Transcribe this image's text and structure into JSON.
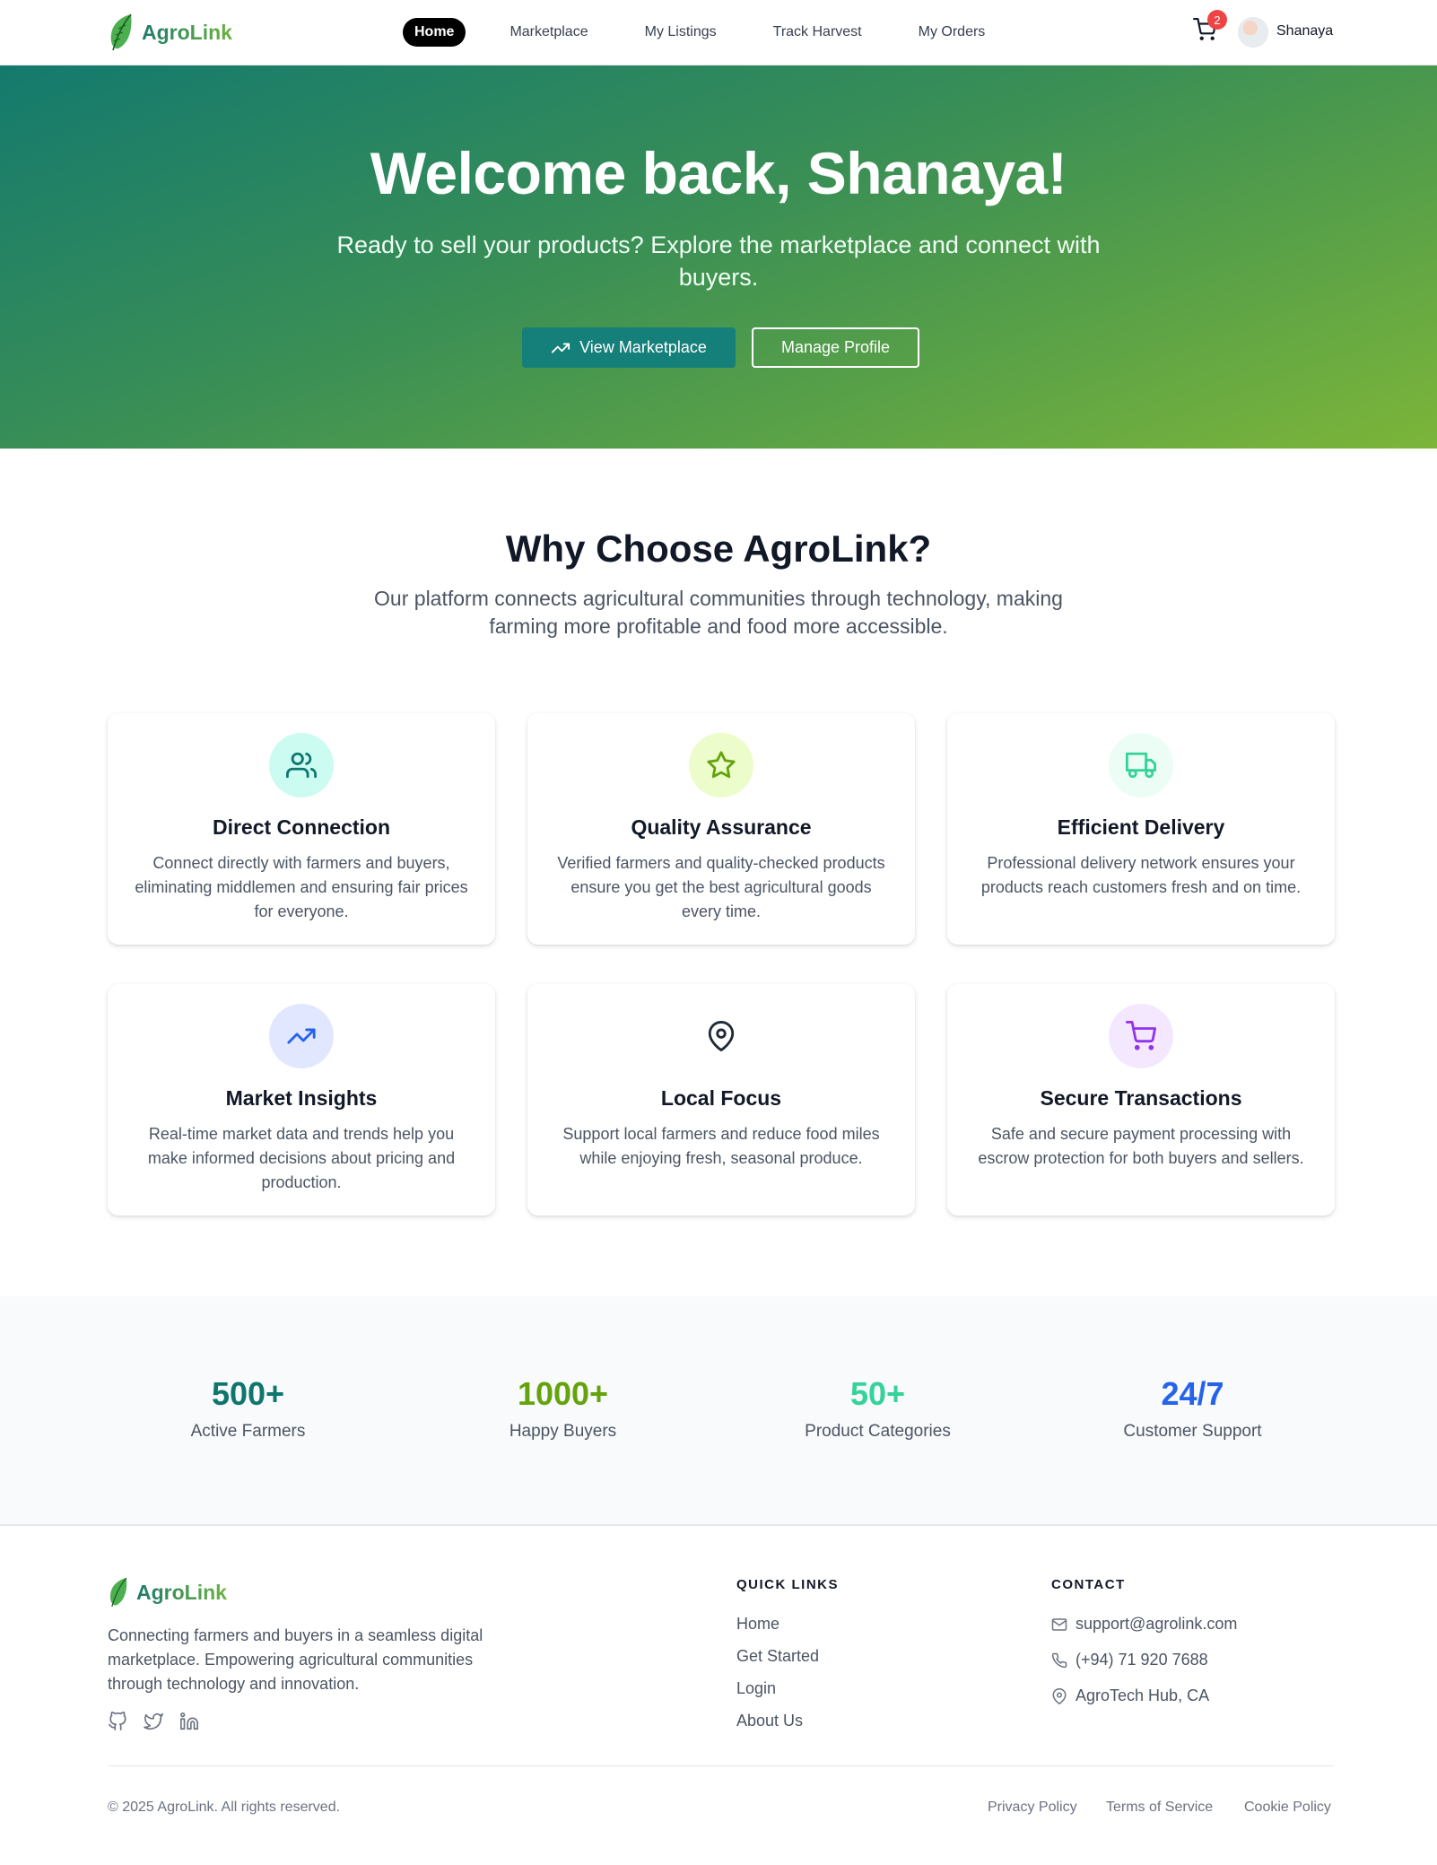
{
  "brand": {
    "name": "AgroLink"
  },
  "nav": {
    "links": [
      "Home",
      "Marketplace",
      "My Listings",
      "Track Harvest",
      "My Orders"
    ],
    "active": "Home",
    "cart_count": "2",
    "user_name": "Shanaya"
  },
  "hero": {
    "title": "Welcome back, Shanaya!",
    "subtitle": "Ready to sell your products? Explore the marketplace and connect with buyers.",
    "primary_button": "View Marketplace",
    "secondary_button": "Manage Profile"
  },
  "why": {
    "title": "Why Choose AgroLink?",
    "subtitle": "Our platform connects agricultural communities through technology, making farming more profitable and food more accessible.",
    "features": [
      {
        "icon": "users-icon",
        "title": "Direct Connection",
        "description": "Connect directly with farmers and buyers, eliminating middlemen and ensuring fair prices for everyone.",
        "color": "#0f766e",
        "bg": "#ccfbf1"
      },
      {
        "icon": "star-icon",
        "title": "Quality Assurance",
        "description": "Verified farmers and quality-checked products ensure you get the best agricultural goods every time.",
        "color": "#65a30d",
        "bg": "#ecfccb"
      },
      {
        "icon": "truck-icon",
        "title": "Efficient Delivery",
        "description": "Professional delivery network ensures your products reach customers fresh and on time.",
        "color": "#34d399",
        "bg": "#ecfdf5"
      },
      {
        "icon": "trending-up-icon",
        "title": "Market Insights",
        "description": "Real-time market data and trends help you make informed decisions about pricing and production.",
        "color": "#2563eb",
        "bg": "#e0e7ff"
      },
      {
        "icon": "map-pin-icon",
        "title": "Local Focus",
        "description": "Support local farmers and reduce food miles while enjoying fresh, seasonal produce.",
        "color": "#1f2937",
        "bg": "#ffffff"
      },
      {
        "icon": "shopping-cart-icon",
        "title": "Secure Transactions",
        "description": "Safe and secure payment processing with escrow protection for both buyers and sellers.",
        "color": "#9333ea",
        "bg": "#f3e8ff"
      }
    ]
  },
  "stats": [
    {
      "value": "500+",
      "label": "Active Farmers",
      "color": "#0f766e"
    },
    {
      "value": "1000+",
      "label": "Happy Buyers",
      "color": "#65a30d"
    },
    {
      "value": "50+",
      "label": "Product Categories",
      "color": "#34d399"
    },
    {
      "value": "24/7",
      "label": "Customer Support",
      "color": "#2563eb"
    }
  ],
  "footer": {
    "description": "Connecting farmers and buyers in a seamless digital marketplace. Empowering agricultural communities through technology and innovation.",
    "social_icons": [
      "github-icon",
      "twitter-icon",
      "linkedin-icon"
    ],
    "quick_links_title": "QUICK LINKS",
    "quick_links": [
      "Home",
      "Get Started",
      "Login",
      "About Us"
    ],
    "contact_title": "CONTACT",
    "contact": {
      "email": "support@agrolink.com",
      "phone": "(+94) 71 920 7688",
      "address": "AgroTech Hub, CA"
    },
    "copyright": "© 2025 AgroLink. All rights reserved.",
    "legal_links": [
      "Privacy Policy",
      "Terms of Service",
      "Cookie Policy"
    ]
  }
}
